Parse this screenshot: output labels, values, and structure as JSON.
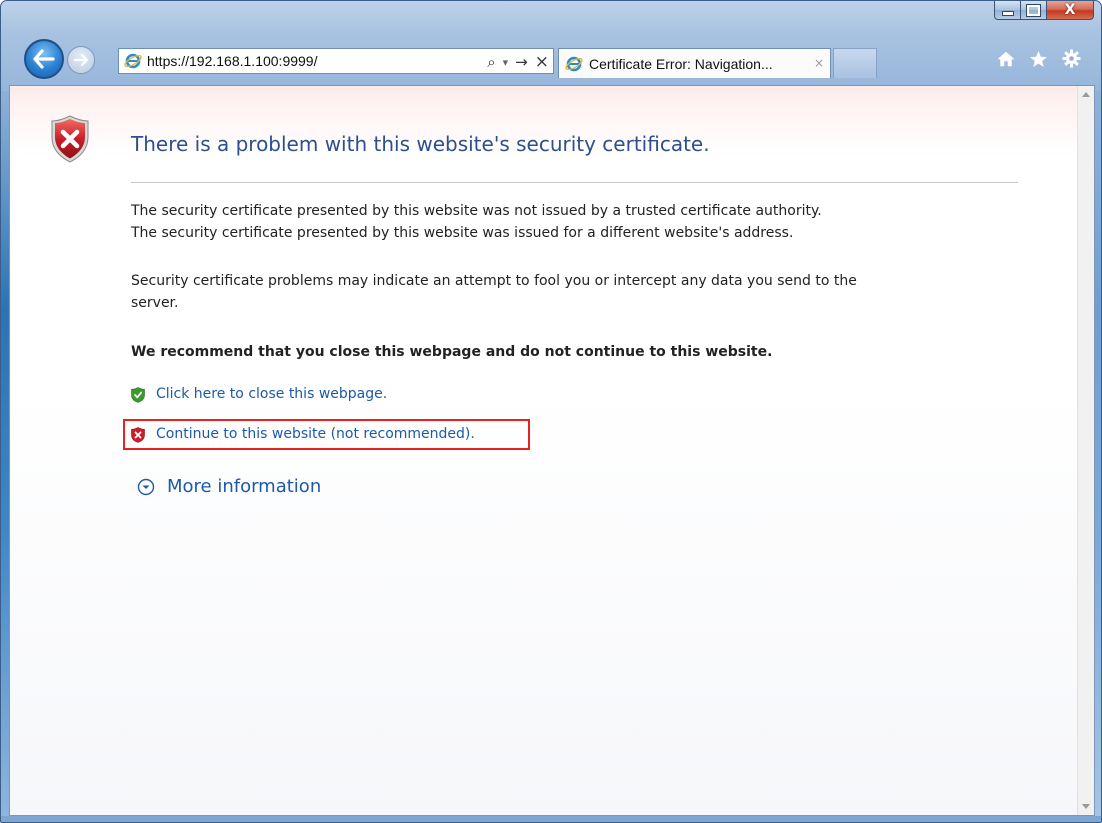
{
  "window": {
    "controls": {
      "minimize_icon": "minimize-icon",
      "maximize_icon": "maximize-icon",
      "close_label": "X"
    }
  },
  "navigation": {
    "back_icon": "back-arrow-icon",
    "forward_icon": "forward-arrow-icon"
  },
  "address_bar": {
    "url": "https://192.168.1.100:9999/",
    "site_icon": "ie-logo-icon",
    "tools": {
      "search_glyph": "⌕",
      "dropdown_glyph": "▾",
      "go_glyph": "→",
      "stop_glyph": "×"
    }
  },
  "tabs": [
    {
      "label": "Certificate Error: Navigation...",
      "icon": "ie-logo-icon",
      "close_glyph": "×"
    }
  ],
  "toolbar_icons": [
    "home-icon",
    "favorites-star-icon",
    "settings-gear-icon"
  ],
  "page": {
    "title": "There is a problem with this website's security certificate.",
    "paragraph1_line1": "The security certificate presented by this website was not issued by a trusted certificate authority.",
    "paragraph1_line2": "The security certificate presented by this website was issued for a different website's address.",
    "paragraph2_line1": "Security certificate problems may indicate an attempt to fool you or intercept any data you send to the",
    "paragraph2_line2": "server.",
    "recommendation": "We recommend that you close this webpage and do not continue to this website.",
    "close_link": "Click here to close this webpage.",
    "continue_link": "Continue to this website (not recommended).",
    "more_info": "More information"
  },
  "colors": {
    "title_blue": "#2c4f8f",
    "link_blue": "#1c5aa8",
    "highlight_red": "#e8231f",
    "shield_red": "#c8202a",
    "shield_green": "#3a9a2e"
  }
}
